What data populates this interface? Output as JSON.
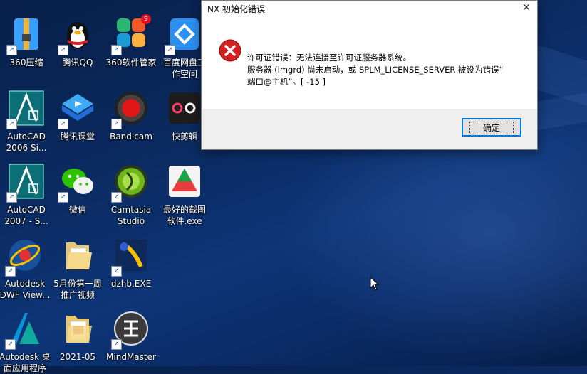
{
  "desktop": {
    "icons": [
      {
        "label": "360压缩",
        "icon": "zip-archive-icon"
      },
      {
        "label": "腾讯QQ",
        "icon": "qq-penguin-icon"
      },
      {
        "label": "360软件管家",
        "icon": "software-manager-icon",
        "badge": "9"
      },
      {
        "label": "百度网盘工\n作空间",
        "icon": "baidu-netdisk-icon"
      },
      {
        "label": "AutoCAD\n2006 Si...",
        "icon": "autocad-icon"
      },
      {
        "label": "腾讯课堂",
        "icon": "tencent-classroom-icon"
      },
      {
        "label": "Bandicam",
        "icon": "bandicam-record-icon"
      },
      {
        "label": "快剪辑",
        "icon": "video-editor-icon"
      },
      {
        "label": "AutoCAD\n2007 - S...",
        "icon": "autocad-icon"
      },
      {
        "label": "微信",
        "icon": "wechat-icon"
      },
      {
        "label": "Camtasia\nStudio",
        "icon": "camtasia-icon"
      },
      {
        "label": "最好的截图\n软件.exe",
        "icon": "screenshot-tool-icon"
      },
      {
        "label": "Autodesk\nDWF View...",
        "icon": "dwf-viewer-icon"
      },
      {
        "label": "5月份第一周\n推广视频",
        "icon": "folder-icon"
      },
      {
        "label": "dzhb.EXE",
        "icon": "dzhb-app-icon"
      },
      {
        "label": "Autodesk 桌\n面应用程序",
        "icon": "autodesk-desktop-icon"
      },
      {
        "label": "2021-05",
        "icon": "folder-icon"
      },
      {
        "label": "MindMaster",
        "icon": "mindmaster-icon"
      }
    ]
  },
  "dialog": {
    "title": "NX 初始化错误",
    "close_symbol": "✕",
    "message_line1": "许可证错误：无法连接至许可证服务器系统。",
    "message_line2": "服务器 (lmgrd) 尚未启动，或 SPLM_LICENSE_SERVER 被设为错误“",
    "message_line3": "端口@主机”。[ -15 ]",
    "ok_label": "确定",
    "error_icon": "error-x-icon"
  }
}
